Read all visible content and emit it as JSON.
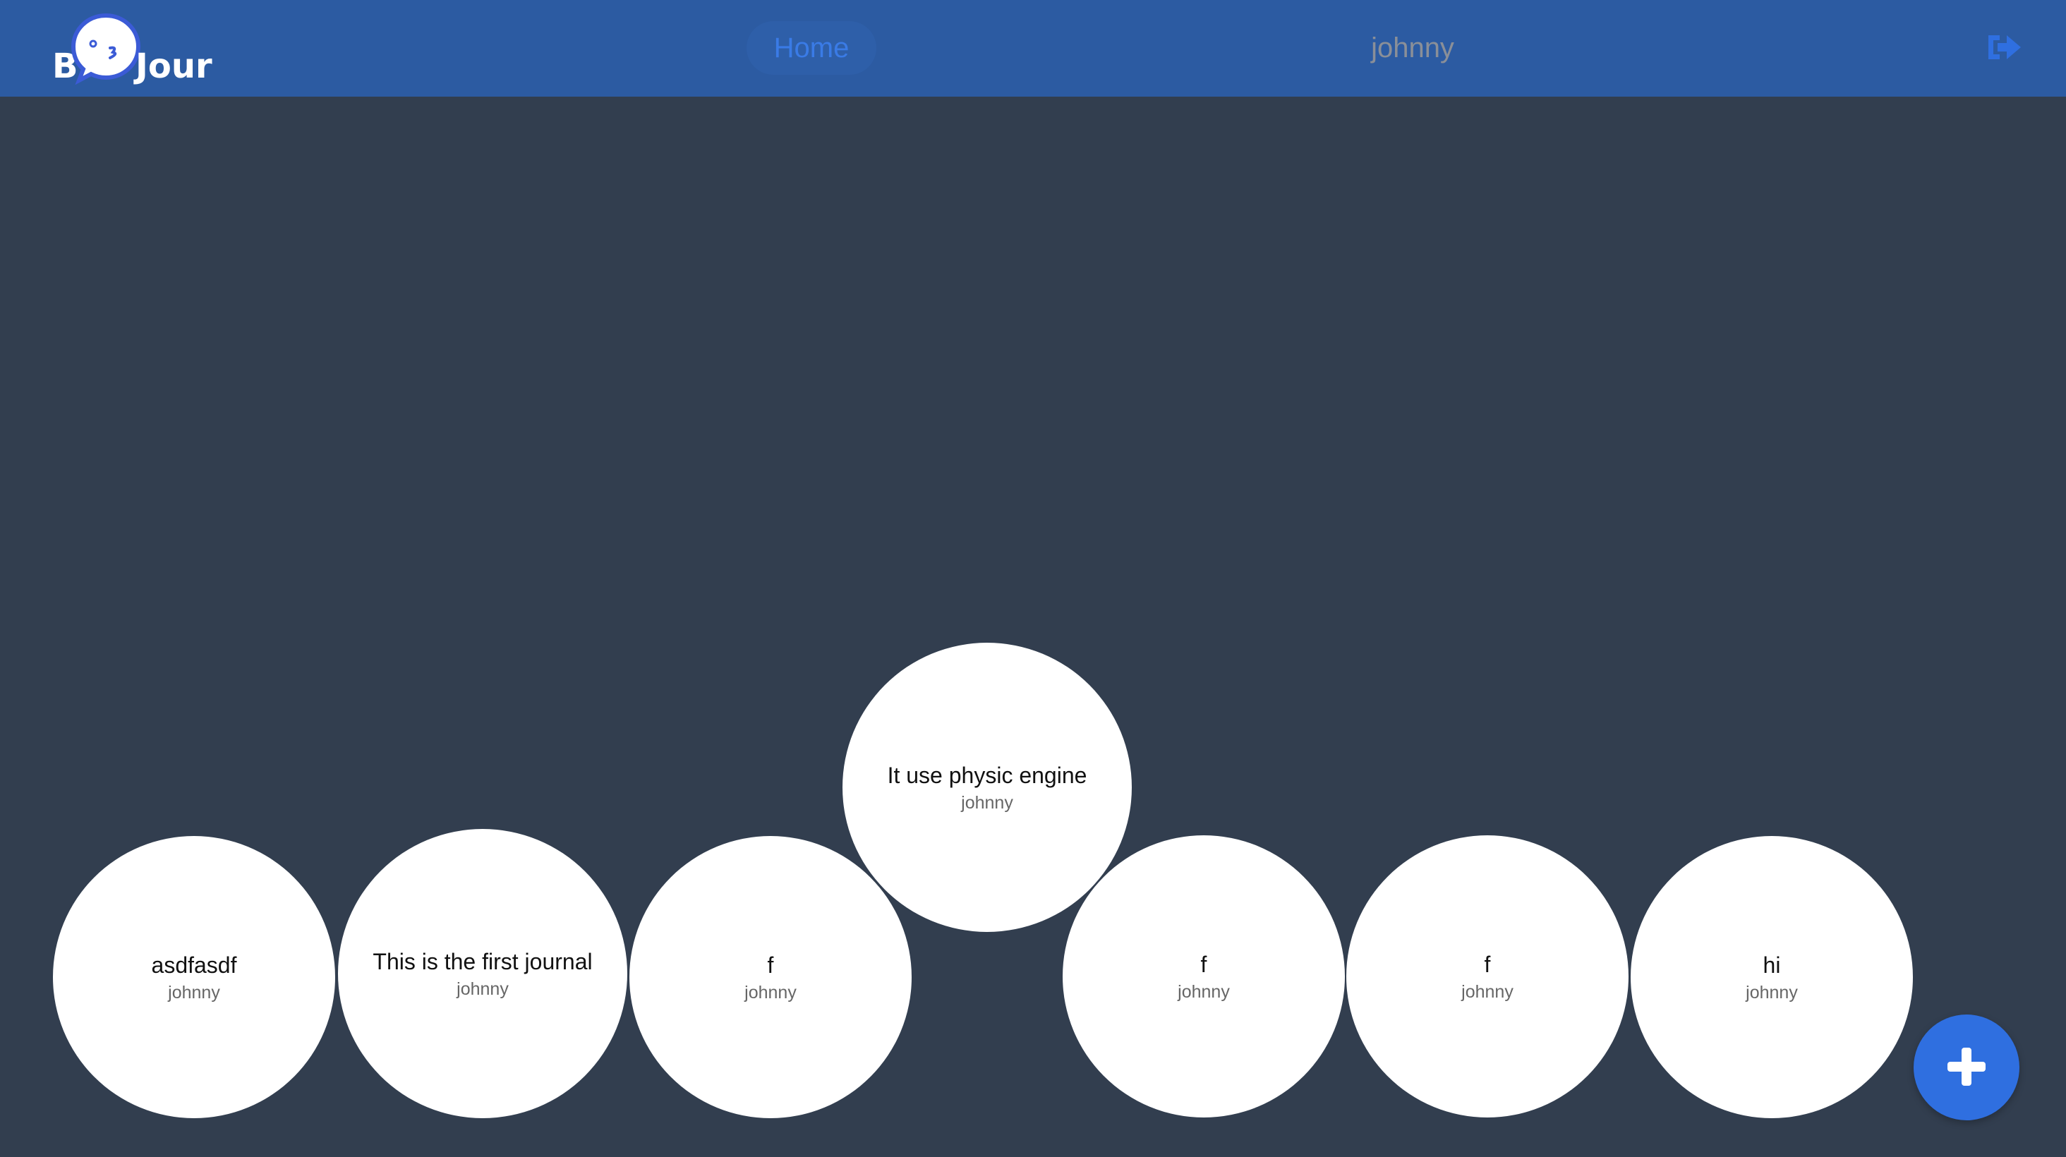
{
  "header": {
    "logo": {
      "text_left": "B",
      "text_right": "Jour"
    },
    "nav": {
      "home_label": "Home",
      "username": "johnny"
    },
    "logout_icon": "sign-out-icon"
  },
  "journals": [
    {
      "title": "asdfasdf",
      "author": "johnny"
    },
    {
      "title": "This is the first journal",
      "author": "johnny"
    },
    {
      "title": "f",
      "author": "johnny"
    },
    {
      "title": "It use physic engine",
      "author": "johnny"
    },
    {
      "title": "f",
      "author": "johnny"
    },
    {
      "title": "f",
      "author": "johnny"
    },
    {
      "title": "hi",
      "author": "johnny"
    }
  ],
  "fab_icon": "plus-icon",
  "colors": {
    "header_bg": "#2c5ba2",
    "page_bg": "#323e4f",
    "accent": "#2f6fe0",
    "bubble_bg": "#ffffff"
  }
}
